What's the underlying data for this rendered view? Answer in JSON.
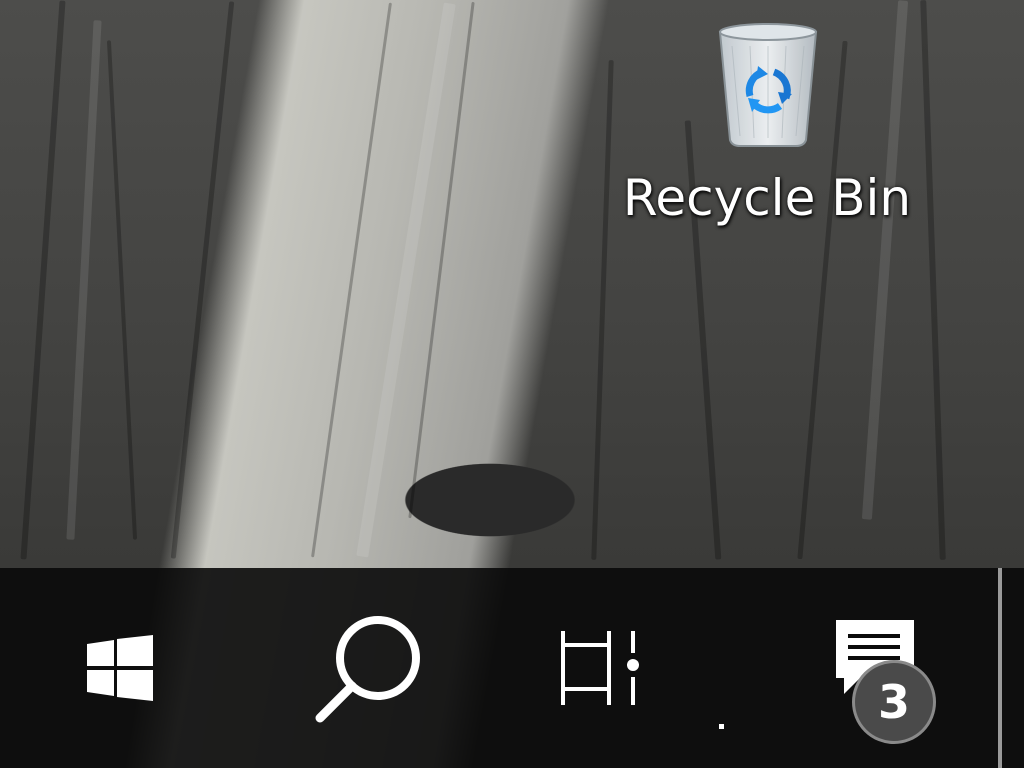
{
  "desktop": {
    "icons": [
      {
        "label": "Recycle Bin",
        "icon": "recycle-bin-icon"
      }
    ]
  },
  "taskbar": {
    "start": {
      "icon": "windows-logo-icon"
    },
    "search": {
      "icon": "search-icon"
    },
    "task_view": {
      "icon": "task-view-icon"
    },
    "action_center": {
      "icon": "notification-icon",
      "badge_count": "3"
    }
  },
  "colors": {
    "taskbar_bg": "#0a0a0a",
    "recycle_blue": "#1e88e5",
    "text": "#ffffff"
  }
}
